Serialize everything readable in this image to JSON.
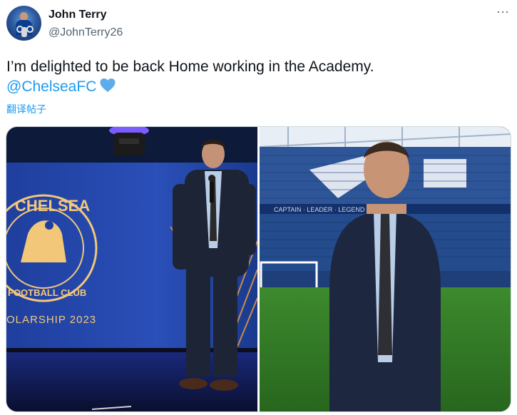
{
  "user": {
    "display_name": "John Terry",
    "handle": "@JohnTerry26",
    "avatar_icon": "avatar-trophy"
  },
  "menu": {
    "more_glyph": "···",
    "icon": "more-horizontal-icon"
  },
  "tweet": {
    "text": "I’m delighted to be back Home working in the Academy.",
    "mention": "@ChelseaFC",
    "emoji_icon": "blue-heart-icon",
    "translate_label": "翻译帖子"
  },
  "media": {
    "photos": [
      {
        "subject": "john-terry-stage-speech",
        "stage_text_1": "CHELSEA",
        "stage_text_2": "FOOTBALL CLUB",
        "stage_text_3": "OLARSHIP 2023"
      },
      {
        "subject": "john-terry-stadium-pitch",
        "stand_text": "CAPTAIN · LEADER · LEGEND"
      }
    ]
  },
  "colors": {
    "link": "#1d9bf0",
    "text": "#0f1419",
    "secondary": "#536471",
    "border": "#cfd9de"
  }
}
